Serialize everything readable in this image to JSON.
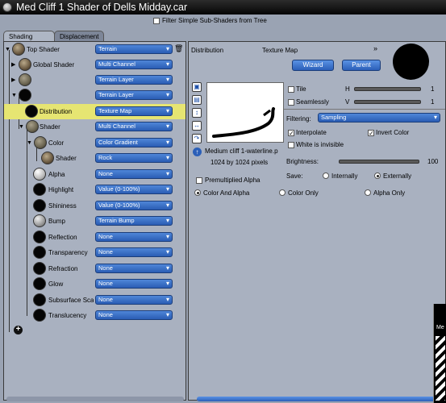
{
  "window": {
    "title": "Med Cliff 1 Shader of Dells Midday.car"
  },
  "filter": {
    "label": "Filter Simple Sub-Shaders from Tree",
    "checked": false
  },
  "tabs": [
    {
      "label": "Shading",
      "active": true
    },
    {
      "label": "Displacement",
      "active": false
    }
  ],
  "tree": [
    {
      "label": "Top Shader",
      "value": "Terrain"
    },
    {
      "label": "Global Shader",
      "value": "Multi Channel"
    },
    {
      "label": "",
      "value": "Terrain Layer"
    },
    {
      "label": "",
      "value": "Terrain Layer"
    },
    {
      "label": "Distribution",
      "value": "Texture Map"
    },
    {
      "label": "Shader",
      "value": "Multi Channel"
    },
    {
      "label": "Color",
      "value": "Color Gradient"
    },
    {
      "label": "Shader",
      "value": "Rock"
    },
    {
      "label": "Alpha",
      "value": "None"
    },
    {
      "label": "Highlight",
      "value": "Value (0-100%)"
    },
    {
      "label": "Shininess",
      "value": "Value (0-100%)"
    },
    {
      "label": "Bump",
      "value": "Terrain Bump"
    },
    {
      "label": "Reflection",
      "value": "None"
    },
    {
      "label": "Transparency",
      "value": "None"
    },
    {
      "label": "Refraction",
      "value": "None"
    },
    {
      "label": "Glow",
      "value": "None"
    },
    {
      "label": "Subsurface Sca",
      "value": "None"
    },
    {
      "label": "Translucency",
      "value": "None"
    }
  ],
  "right": {
    "header_left": "Distribution",
    "header_type": "Texture Map",
    "wizard": "Wizard",
    "parent": "Parent",
    "filename": "Medium cliff 1-waterline.p",
    "size": "1024 by 1024 pixels",
    "premultiplied": "Premultiplied Alpha",
    "tile": "Tile",
    "seamless": "Seamlessly",
    "h": "H",
    "v": "V",
    "hv_end": "1",
    "filtering_label": "Filtering:",
    "filtering_value": "Sampling",
    "interpolate": "Interpolate",
    "invert": "Invert Color",
    "white_invisible": "White is invisible",
    "brightness_label": "Brightness:",
    "brightness_value": "100",
    "save_label": "Save:",
    "internally": "Internally",
    "externally": "Externally",
    "color_alpha": "Color And Alpha",
    "color_only": "Color Only",
    "alpha_only": "Alpha Only"
  },
  "corner_window": {
    "title": "Me"
  },
  "colors": {
    "accent": "#2b5fb8",
    "highlight": "#e6e572",
    "panel": "#a9b1c0"
  }
}
